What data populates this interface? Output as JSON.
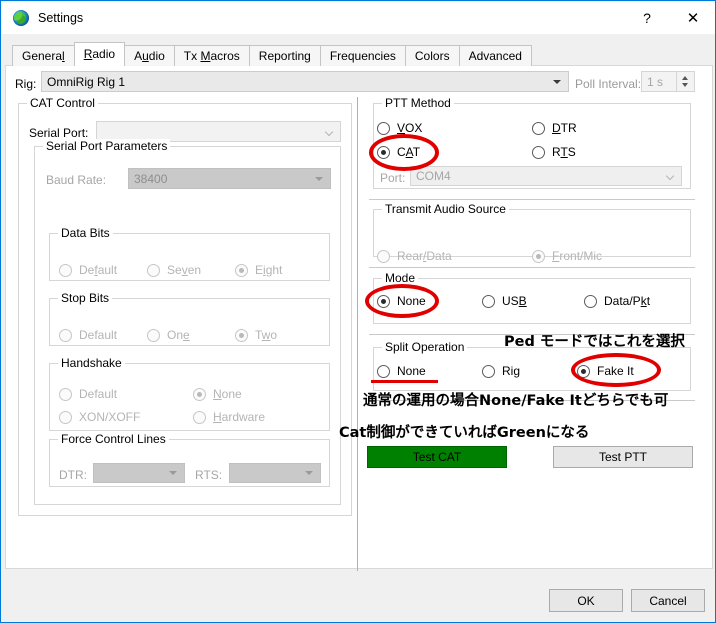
{
  "window": {
    "title": "Settings",
    "icon": "globe-icon",
    "help_label": "?",
    "close_label": "✕"
  },
  "tabs": [
    {
      "label": "General",
      "pre": "G",
      "accel": "",
      "post": "eneral",
      "active": false
    },
    {
      "label": "Radio",
      "active": true
    },
    {
      "label": "Audio",
      "active": false
    },
    {
      "label": "Tx Macros",
      "active": false
    },
    {
      "label": "Reporting",
      "active": false
    },
    {
      "label": "Frequencies",
      "active": false
    },
    {
      "label": "Colors",
      "active": false
    },
    {
      "label": "Advanced",
      "active": false
    }
  ],
  "rig": {
    "label": "Rig:",
    "value": "OmniRig Rig 1",
    "poll_label": "Poll Interval:",
    "poll_value": "1 s"
  },
  "cat_control": {
    "legend": "CAT Control",
    "serial_port_label": "Serial Port:",
    "serial_port_value": "",
    "serial_params": {
      "legend": "Serial Port Parameters",
      "baud_label": "Baud Rate:",
      "baud_value": "38400",
      "data_bits": {
        "legend": "Data Bits",
        "options": [
          {
            "label": "Default",
            "selected": false
          },
          {
            "label": "Seven",
            "selected": false
          },
          {
            "label": "Eight",
            "selected": true
          }
        ]
      },
      "stop_bits": {
        "legend": "Stop Bits",
        "options": [
          {
            "label": "Default",
            "selected": false
          },
          {
            "label": "One",
            "selected": false
          },
          {
            "label": "Two",
            "selected": true
          }
        ]
      },
      "handshake": {
        "legend": "Handshake",
        "options": [
          {
            "label": "Default",
            "selected": false
          },
          {
            "label": "None",
            "selected": true
          },
          {
            "label": "XON/XOFF",
            "selected": false
          },
          {
            "label": "Hardware",
            "selected": false
          }
        ]
      },
      "force_control_lines": {
        "legend": "Force Control Lines",
        "dtr_label": "DTR:",
        "dtr_value": "",
        "rts_label": "RTS:",
        "rts_value": ""
      }
    }
  },
  "ptt_method": {
    "legend": "PTT Method",
    "options": [
      {
        "label": "VOX",
        "selected": false
      },
      {
        "label": "DTR",
        "selected": false
      },
      {
        "label": "CAT",
        "selected": true
      },
      {
        "label": "RTS",
        "selected": false
      }
    ],
    "port_label": "Port:",
    "port_value": "COM4"
  },
  "transmit_audio_source": {
    "legend": "Transmit Audio Source",
    "options": [
      {
        "label": "Rear/Data",
        "selected": false
      },
      {
        "label": "Front/Mic",
        "selected": true
      }
    ]
  },
  "mode": {
    "legend": "Mode",
    "options": [
      {
        "label": "None",
        "selected": true
      },
      {
        "label": "USB",
        "selected": false
      },
      {
        "label": "Data/Pkt",
        "selected": false
      }
    ]
  },
  "split_operation": {
    "legend": "Split Operation",
    "options": [
      {
        "label": "None",
        "selected": false
      },
      {
        "label": "Rig",
        "selected": false
      },
      {
        "label": "Fake It",
        "selected": true
      }
    ]
  },
  "test_buttons": {
    "test_cat": "Test CAT",
    "test_ptt": "Test PTT",
    "test_cat_color": "#008000"
  },
  "annotations": {
    "ped_mode": "Ped モードではこれを選択",
    "normal_use": "通常の運用の場合None/Fake Itどちらでも可",
    "cat_green": "Cat制御ができていればGreenになる",
    "highlight_color": "#e00000"
  },
  "footer": {
    "ok": "OK",
    "cancel": "Cancel"
  }
}
